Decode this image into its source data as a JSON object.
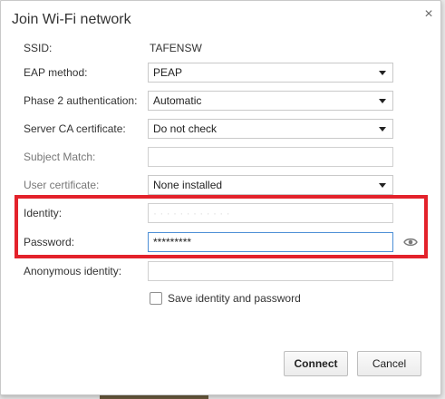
{
  "dialog": {
    "title": "Join Wi-Fi network",
    "close_glyph": "×",
    "close_icon": "close-icon"
  },
  "fields": {
    "ssid": {
      "label": "SSID:",
      "value": "TAFENSW"
    },
    "eap_method": {
      "label": "EAP method:",
      "value": "PEAP"
    },
    "phase2_auth": {
      "label": "Phase 2 authentication:",
      "value": "Automatic"
    },
    "server_ca": {
      "label": "Server CA certificate:",
      "value": "Do not check"
    },
    "subject_match": {
      "label": "Subject Match:",
      "value": ""
    },
    "user_certificate": {
      "label": "User certificate:",
      "value": "None installed"
    },
    "identity": {
      "label": "Identity:",
      "value": "· · · · · · · · · · · ·"
    },
    "password": {
      "label": "Password:",
      "value": "*********",
      "show_icon": "eye-icon"
    },
    "anonymous_identity": {
      "label": "Anonymous identity:",
      "value": ""
    }
  },
  "save_identity": {
    "label": "Save identity and password",
    "checked": false
  },
  "buttons": {
    "connect": "Connect",
    "cancel": "Cancel"
  },
  "colors": {
    "highlight": "#e3222b",
    "focus": "#4d8fd6"
  }
}
